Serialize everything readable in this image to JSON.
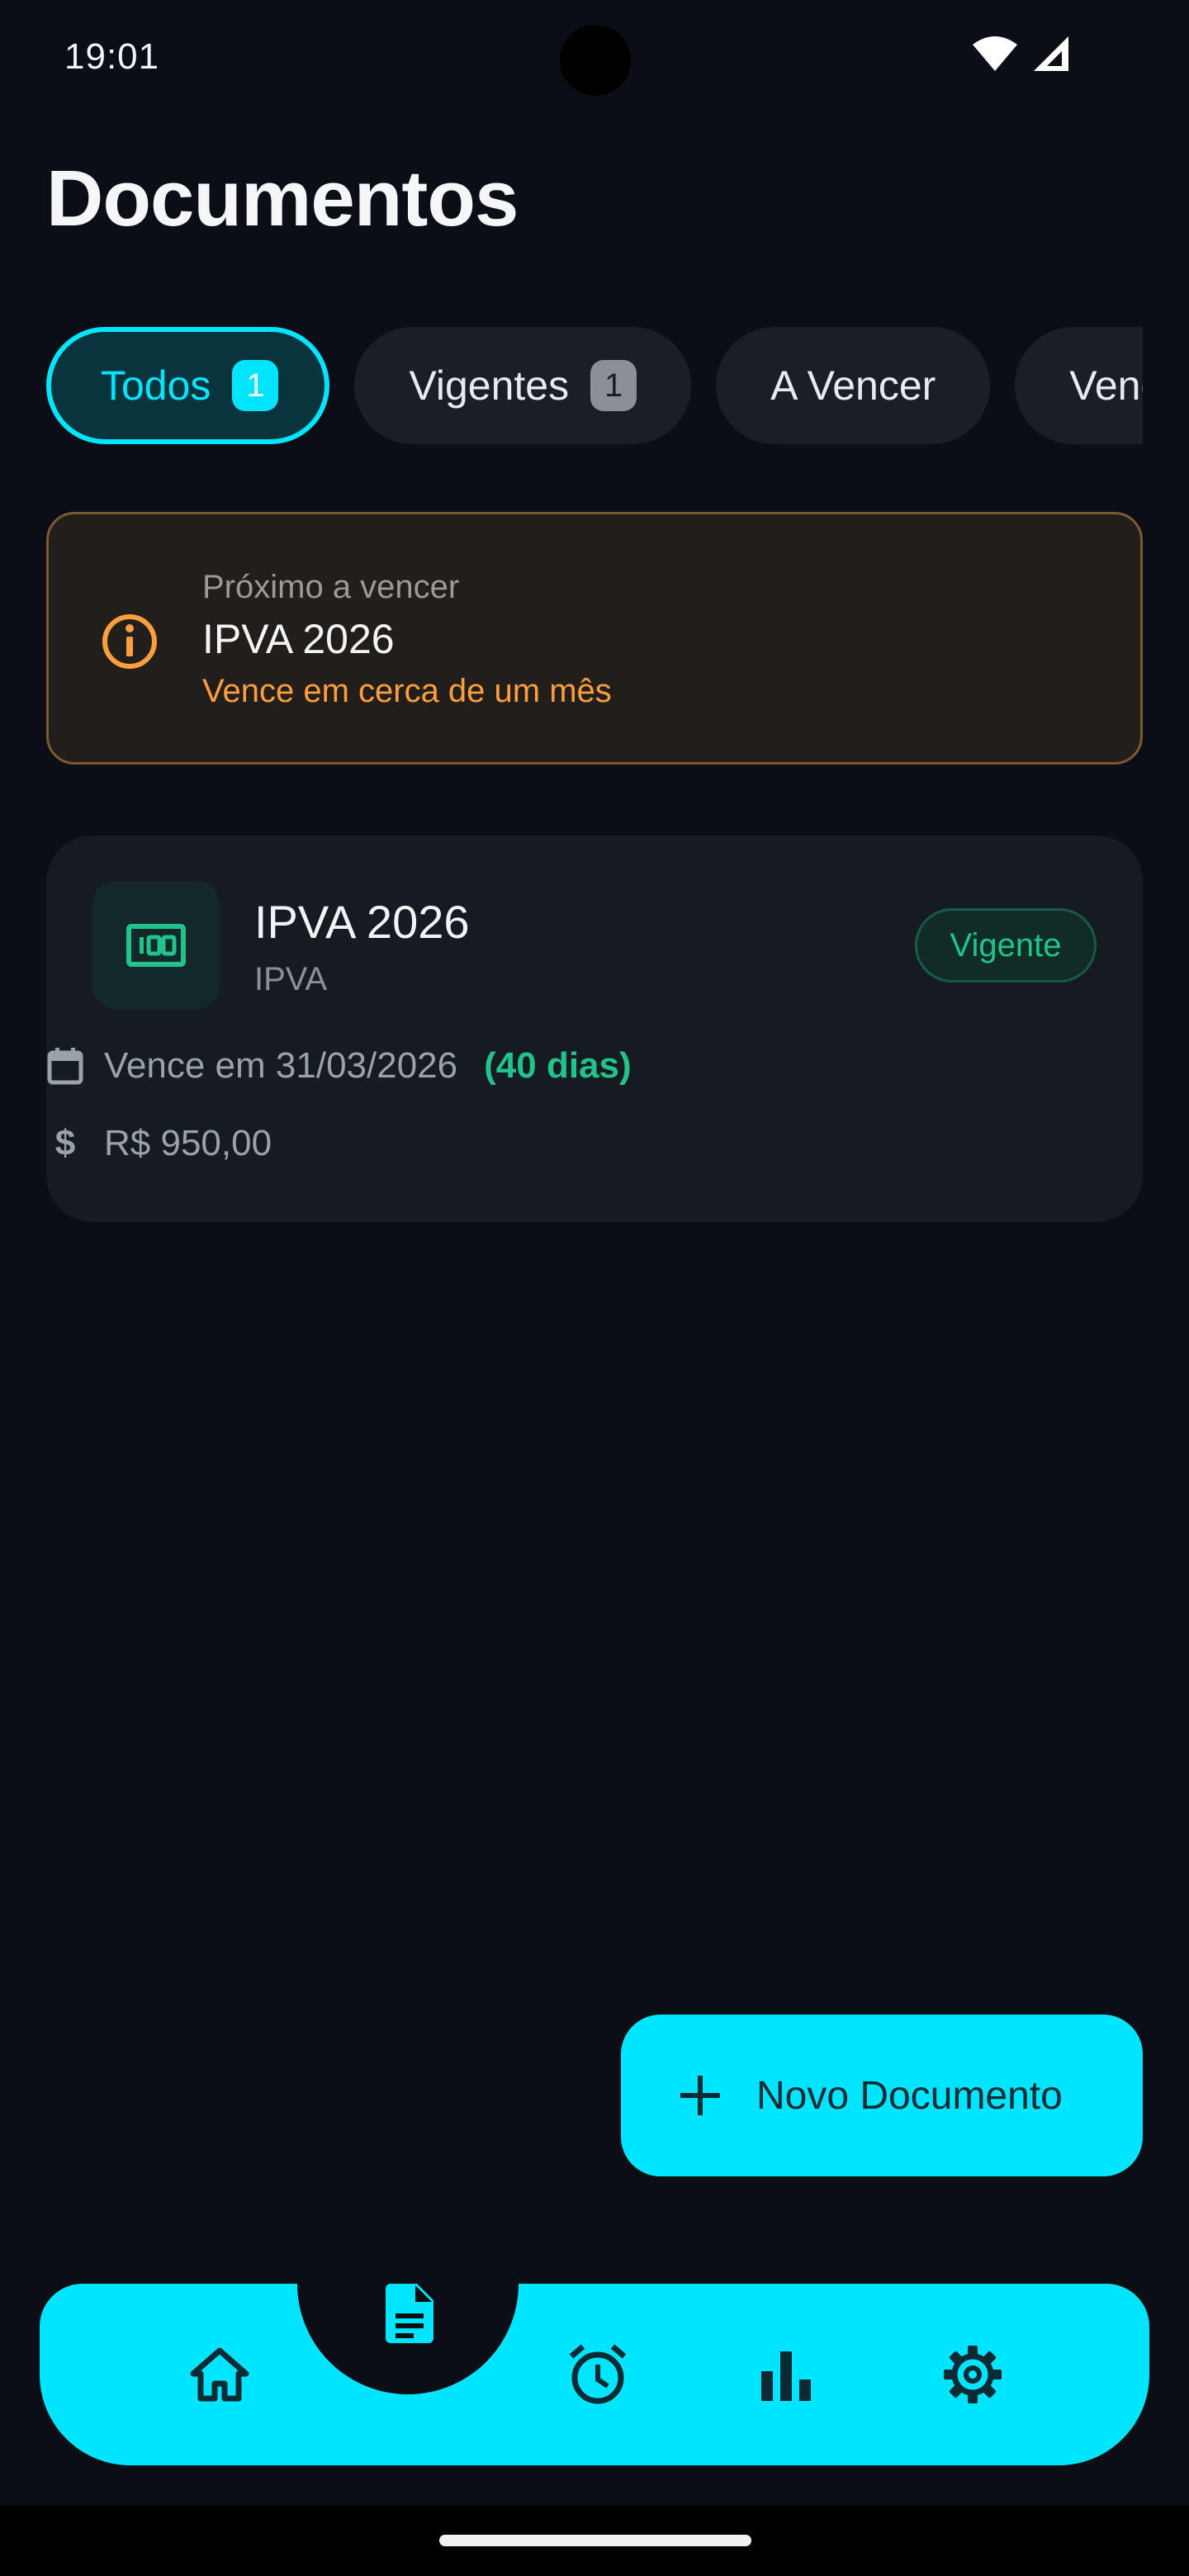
{
  "status_bar": {
    "time": "19:01"
  },
  "page": {
    "title": "Documentos"
  },
  "tabs": [
    {
      "label": "Todos",
      "count": "1"
    },
    {
      "label": "Vigentes",
      "count": "1"
    },
    {
      "label": "A Vencer"
    },
    {
      "label": "Vencidos"
    }
  ],
  "alert": {
    "label": "Próximo a vencer",
    "title": "IPVA 2026",
    "subtitle": "Vence em cerca de um mês",
    "color": "#ff9e3d"
  },
  "document": {
    "title": "IPVA 2026",
    "type": "IPVA",
    "status": "Vigente",
    "due_text": "Vence em 31/03/2026",
    "days_text": "(40 dias)",
    "value_text": "R$ 950,00",
    "status_color": "#22c38a"
  },
  "fab": {
    "label": "Novo Documento"
  },
  "nav": {
    "items": [
      "home-icon",
      "document-icon",
      "alarm-icon",
      "bar-chart-icon",
      "gear-icon"
    ],
    "active": "document-icon",
    "accent": "#00e5ff"
  }
}
